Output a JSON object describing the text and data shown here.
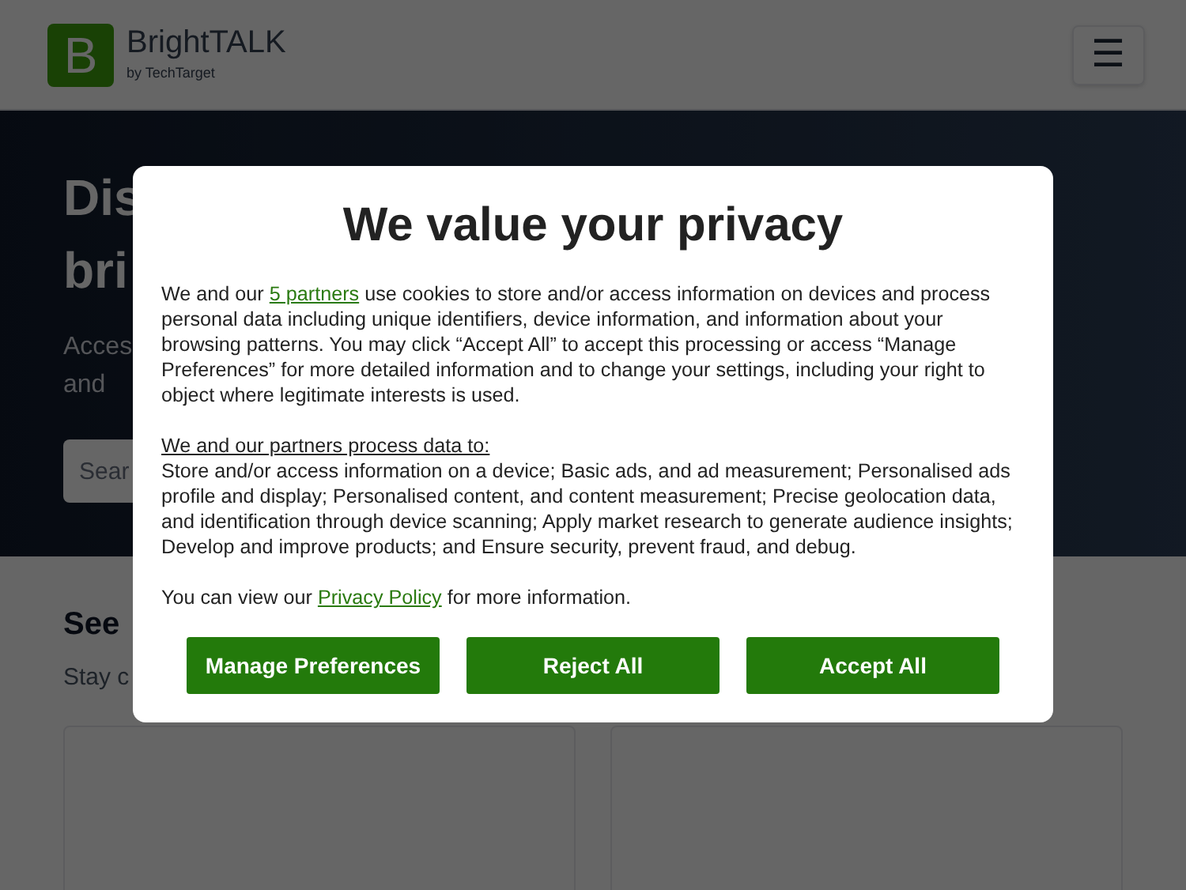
{
  "header": {
    "logo_letter": "B",
    "brand": "BrightTALK",
    "brand_sub": "by TechTarget",
    "menu_button": "☰"
  },
  "hero": {
    "title_lines": [
      "Dis",
      "bri"
    ],
    "subtitle_lines": [
      "Acces",
      "and"
    ],
    "search": {
      "placeholder": "Sear"
    }
  },
  "section": {
    "title": "See",
    "subtitle": "Stay c"
  },
  "consent": {
    "title": "We value your privacy",
    "intro": {
      "before": "We and our ",
      "link": "5 partners",
      "after": " use cookies to store and/or access information on devices and process personal data including unique identifiers, device information, and information about your browsing patterns. You may click “Accept All” to accept this processing or access “Manage Preferences” for more detailed information and to change your settings, including your right to object where legitimate interests is used."
    },
    "purposes_heading": "We and our partners process data to:",
    "purposes": "Store and/or access information on a device; Basic ads, and ad measurement; Personalised ads profile and display; Personalised content, and content measurement; Precise geolocation data, and identification through device scanning; Apply market research to generate audience insights; Develop and improve products; and Ensure security, prevent fraud, and debug.",
    "policy": {
      "before": "You can view our ",
      "link": "Privacy Policy",
      "after": " for more information."
    },
    "buttons": [
      "Manage Preferences",
      "Reject All",
      "Accept All"
    ]
  }
}
